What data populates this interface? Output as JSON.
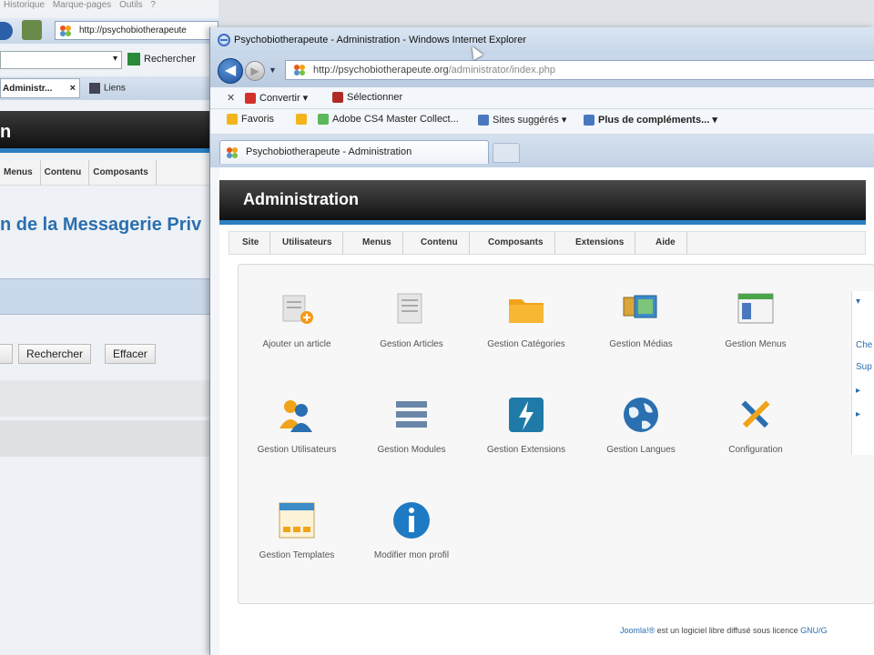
{
  "bg_window": {
    "menubar": [
      "Historique",
      "Marque-pages",
      "Outils",
      "?"
    ],
    "url": "http://psychobiotherapeute",
    "search_button": "Rechercher",
    "tab_active": "Administr...",
    "tab_other": "Liens",
    "header_title": "n",
    "nav": [
      "Menus",
      "Contenu",
      "Composants"
    ],
    "page_title": "n de la Messagerie Priv",
    "btn_rechercher": "Rechercher",
    "btn_effacer": "Effacer"
  },
  "ie": {
    "title": "Psychobiotherapeute - Administration - Windows Internet Explorer",
    "url_host": "http://psychobiotherapeute.org",
    "url_path": "/administrator/index.php",
    "toolbar1": {
      "convertir": "Convertir",
      "selectionner": "Sélectionner"
    },
    "toolbar2": {
      "favoris": "Favoris",
      "adobe": "Adobe CS4 Master Collect...",
      "sites": "Sites suggérés",
      "plus": "Plus de compléments..."
    },
    "tab_title": "Psychobiotherapeute - Administration"
  },
  "joomla": {
    "header": "Administration",
    "nav": [
      "Site",
      "Utilisateurs",
      "Menus",
      "Contenu",
      "Composants",
      "Extensions",
      "Aide"
    ],
    "icons": [
      {
        "label": "Ajouter un article",
        "icon": "add-article-icon"
      },
      {
        "label": "Gestion Articles",
        "icon": "articles-icon"
      },
      {
        "label": "Gestion Catégories",
        "icon": "folder-icon"
      },
      {
        "label": "Gestion Médias",
        "icon": "media-icon"
      },
      {
        "label": "Gestion Menus",
        "icon": "menus-icon"
      },
      {
        "label": "Gestion Utilisateurs",
        "icon": "users-icon"
      },
      {
        "label": "Gestion Modules",
        "icon": "modules-icon"
      },
      {
        "label": "Gestion Extensions",
        "icon": "extensions-icon"
      },
      {
        "label": "Gestion Langues",
        "icon": "globe-icon"
      },
      {
        "label": "Configuration",
        "icon": "tools-icon"
      },
      {
        "label": "Gestion Templates",
        "icon": "templates-icon"
      },
      {
        "label": "Modifier mon profil",
        "icon": "info-icon"
      }
    ],
    "side_links": [
      "Che",
      "Sup"
    ],
    "footer_link": "Joomla!®",
    "footer_text": " est un logiciel libre diffusé sous licence ",
    "footer_link2": "GNU/G"
  },
  "colors": {
    "accent": "#2b7fc1",
    "header": "#1a1a1a"
  }
}
